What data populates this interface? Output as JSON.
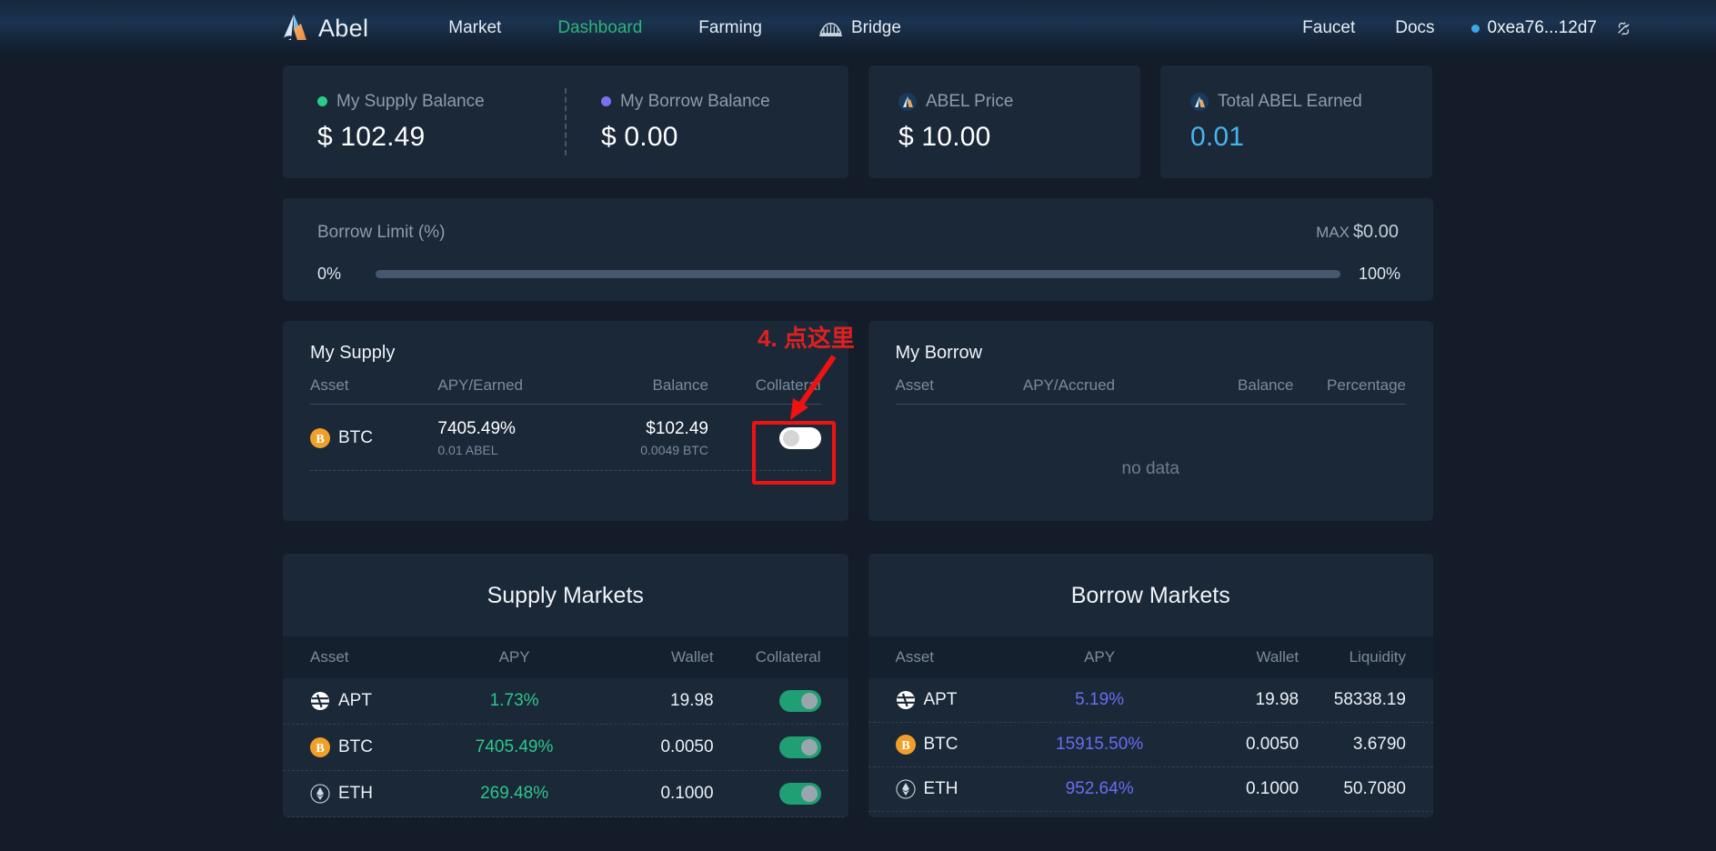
{
  "nav": {
    "brand": "Abel",
    "brand_logo_icon": "abel-mountain-logo",
    "links": [
      {
        "label": "Market",
        "active": false,
        "icon": null
      },
      {
        "label": "Dashboard",
        "active": true,
        "icon": null
      },
      {
        "label": "Farming",
        "active": false,
        "icon": null
      },
      {
        "label": "Bridge",
        "active": false,
        "icon": "bridge-icon"
      }
    ],
    "right_links": [
      {
        "label": "Faucet"
      },
      {
        "label": "Docs"
      }
    ],
    "wallet": {
      "address": "0xea76...12d7",
      "status_dot_color": "#39a9e8",
      "link_icon": "broken-link-icon"
    },
    "active_color": "#2bb579"
  },
  "stats": [
    {
      "label": "My Supply Balance",
      "value": "$ 102.49",
      "dot_color": "#2bcb88",
      "icon": "green-dot-icon"
    },
    {
      "label": "My Borrow Balance",
      "value": "$ 0.00",
      "dot_color": "#7c6ff0",
      "icon": "purple-dot-icon"
    },
    {
      "label": "ABEL Price",
      "value": "$ 10.00",
      "icon": "abel-token-icon"
    },
    {
      "label": "Total ABEL Earned",
      "value": "0.01",
      "icon": "abel-token-icon",
      "value_color": "#46b4ef"
    }
  ],
  "borrow_limit": {
    "title": "Borrow Limit (%)",
    "max_label": "MAX",
    "max_value": "$0.00",
    "min_tick": "0%",
    "max_tick": "100%",
    "progress_percent": 0
  },
  "my_supply": {
    "title": "My Supply",
    "columns": [
      "Asset",
      "APY/Earned",
      "Balance",
      "Collateral"
    ],
    "rows": [
      {
        "asset": "BTC",
        "asset_icon": "btc-coin-icon",
        "apy": "7405.49%",
        "earned": "0.01 ABEL",
        "balance": "$102.49",
        "balance_sub": "0.0049 BTC",
        "collateral_on": false
      }
    ]
  },
  "my_borrow": {
    "title": "My Borrow",
    "columns": [
      "Asset",
      "APY/Accrued",
      "Balance",
      "Percentage"
    ],
    "empty_text": "no data",
    "rows": []
  },
  "supply_markets": {
    "title": "Supply Markets",
    "columns": [
      "Asset",
      "APY",
      "Wallet",
      "Collateral"
    ],
    "rows": [
      {
        "asset": "APT",
        "asset_icon": "apt-coin-icon",
        "apy": "1.73%",
        "wallet": "19.98",
        "collateral_on": true
      },
      {
        "asset": "BTC",
        "asset_icon": "btc-coin-icon",
        "apy": "7405.49%",
        "wallet": "0.0050",
        "collateral_on": true
      },
      {
        "asset": "ETH",
        "asset_icon": "eth-coin-icon",
        "apy": "269.48%",
        "wallet": "0.1000",
        "collateral_on": true
      }
    ],
    "apy_color": "#2bc98a"
  },
  "borrow_markets": {
    "title": "Borrow Markets",
    "columns": [
      "Asset",
      "APY",
      "Wallet",
      "Liquidity"
    ],
    "rows": [
      {
        "asset": "APT",
        "asset_icon": "apt-coin-icon",
        "apy": "5.19%",
        "wallet": "19.98",
        "liquidity": "58338.19"
      },
      {
        "asset": "BTC",
        "asset_icon": "btc-coin-icon",
        "apy": "15915.50%",
        "wallet": "0.0050",
        "liquidity": "3.6790"
      },
      {
        "asset": "ETH",
        "asset_icon": "eth-coin-icon",
        "apy": "952.64%",
        "wallet": "0.1000",
        "liquidity": "50.7080"
      }
    ],
    "apy_color": "#6b6cf0"
  },
  "annotation": {
    "text": "4. 点这里",
    "color": "#e02020",
    "arrow_icon": "red-arrow-icon",
    "highlight_icon": "red-rectangle-highlight"
  }
}
